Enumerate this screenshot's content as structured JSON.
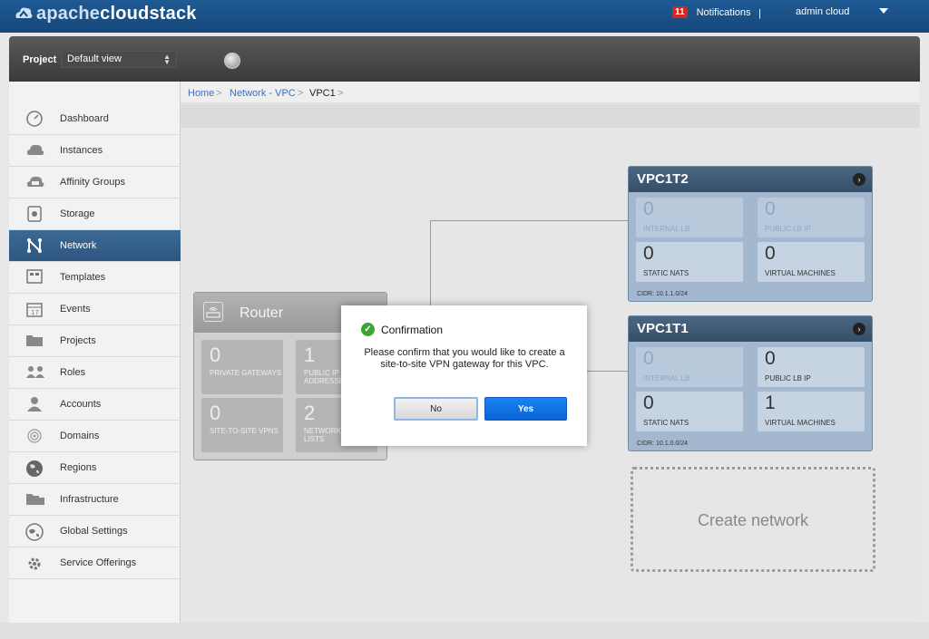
{
  "header": {
    "logo_prefix": "apache",
    "logo_suffix": "cloudstack",
    "notifications_count": "11",
    "notifications_label": "Notifications",
    "separator": "|",
    "user": "admin cloud"
  },
  "project": {
    "label": "Project",
    "selected": "Default view"
  },
  "sidebar": {
    "items": [
      {
        "label": "Dashboard",
        "icon": "dashboard-icon"
      },
      {
        "label": "Instances",
        "icon": "cloud-icon"
      },
      {
        "label": "Affinity Groups",
        "icon": "affinity-icon"
      },
      {
        "label": "Storage",
        "icon": "storage-icon"
      },
      {
        "label": "Network",
        "icon": "network-icon",
        "active": true
      },
      {
        "label": "Templates",
        "icon": "templates-icon"
      },
      {
        "label": "Events",
        "icon": "calendar-icon"
      },
      {
        "label": "Projects",
        "icon": "folder-icon"
      },
      {
        "label": "Roles",
        "icon": "roles-icon"
      },
      {
        "label": "Accounts",
        "icon": "user-icon"
      },
      {
        "label": "Domains",
        "icon": "domains-icon"
      },
      {
        "label": "Regions",
        "icon": "globe-icon"
      },
      {
        "label": "Infrastructure",
        "icon": "infrastructure-icon"
      },
      {
        "label": "Global Settings",
        "icon": "settings-icon"
      },
      {
        "label": "Service Offerings",
        "icon": "gear-icon"
      }
    ]
  },
  "breadcrumb": {
    "home": "Home",
    "network_vpc": "Network - VPC",
    "current": "VPC1",
    "gt": ">"
  },
  "router": {
    "title": "Router",
    "tiles": [
      {
        "num": "0",
        "label": "PRIVATE GATEWAYS"
      },
      {
        "num": "1",
        "label": "PUBLIC IP ADDRESSES"
      },
      {
        "num": "0",
        "label": "SITE-TO-SITE VPNS"
      },
      {
        "num": "2",
        "label": "NETWORK ACL LISTS"
      }
    ]
  },
  "tiers": [
    {
      "title": "VPC1T2",
      "tiles": [
        {
          "num": "0",
          "label": "INTERNAL LB"
        },
        {
          "num": "0",
          "label": "PUBLIC LB IP"
        },
        {
          "num": "0",
          "label": "STATIC NATS"
        },
        {
          "num": "0",
          "label": "VIRTUAL MACHINES"
        }
      ],
      "cidr": "CIDR: 10.1.1.0/24"
    },
    {
      "title": "VPC1T1",
      "tiles": [
        {
          "num": "0",
          "label": "INTERNAL LB"
        },
        {
          "num": "0",
          "label": "PUBLIC LB IP"
        },
        {
          "num": "0",
          "label": "STATIC NATS"
        },
        {
          "num": "1",
          "label": "VIRTUAL MACHINES"
        }
      ],
      "cidr": "CIDR: 10.1.0.0/24"
    }
  ],
  "create_network": "Create network",
  "dialog": {
    "title": "Confirmation",
    "message": "Please confirm that you would like to create a site-to-site VPN gateway for this VPC.",
    "no_label": "No",
    "yes_label": "Yes"
  }
}
